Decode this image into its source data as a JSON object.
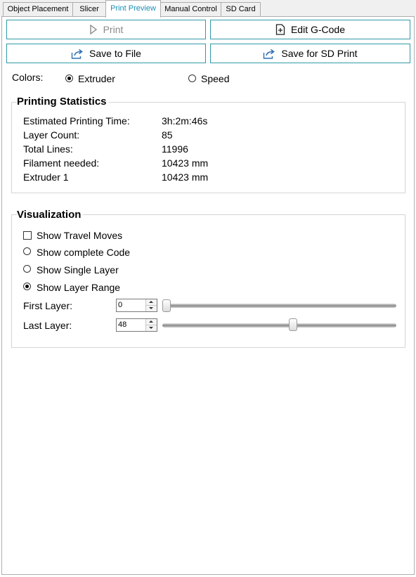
{
  "tabs": [
    {
      "label": "Object Placement"
    },
    {
      "label": "Slicer"
    },
    {
      "label": "Print Preview"
    },
    {
      "label": "Manual Control"
    },
    {
      "label": "SD Card"
    }
  ],
  "buttons": {
    "print": "Print",
    "edit_gcode": "Edit G-Code",
    "save_to_file": "Save to File",
    "save_sd": "Save for SD Print"
  },
  "colors": {
    "label": "Colors:",
    "extruder": "Extruder",
    "speed": "Speed",
    "selected": "Extruder"
  },
  "stats": {
    "title": "Printing Statistics",
    "rows": [
      {
        "label": "Estimated Printing Time:",
        "value": "3h:2m:46s"
      },
      {
        "label": "Layer Count:",
        "value": "85"
      },
      {
        "label": "Total Lines:",
        "value": "11996"
      },
      {
        "label": "Filament needed:",
        "value": "10423 mm"
      },
      {
        "label": "Extruder 1",
        "value": "10423 mm"
      }
    ]
  },
  "visualization": {
    "title": "Visualization",
    "show_travel": "Show Travel Moves",
    "show_travel_checked": false,
    "show_complete": "Show complete Code",
    "show_single": "Show Single Layer",
    "show_range": "Show Layer Range",
    "selected_mode": "Show Layer Range",
    "first_layer_label": "First Layer:",
    "first_layer_value": "0",
    "last_layer_label": "Last Layer:",
    "last_layer_value": "48",
    "first_layer_slider_fraction": 0.0,
    "last_layer_slider_fraction": 0.56
  },
  "accent_color": "#2f9aa8",
  "active_tab_color": "#1a8fb5"
}
